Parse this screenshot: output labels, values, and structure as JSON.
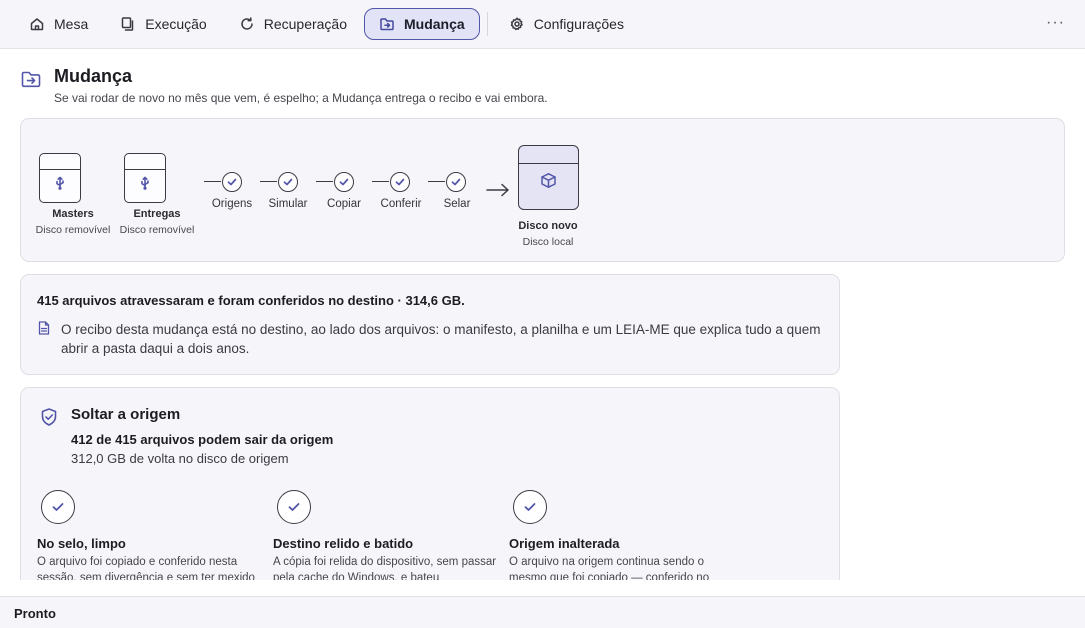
{
  "tabs": [
    {
      "label": "Mesa",
      "icon": "home-icon",
      "active": false
    },
    {
      "label": "Execução",
      "icon": "copy-icon",
      "active": false
    },
    {
      "label": "Recuperação",
      "icon": "refresh-icon",
      "active": false
    },
    {
      "label": "Mudança",
      "icon": "folder-move-icon",
      "active": true
    },
    {
      "label": "Configurações",
      "icon": "gear-icon",
      "active": false
    }
  ],
  "more_label": "···",
  "header": {
    "title": "Mudança",
    "subtitle": "Se vai rodar de novo no mês que vem, é espelho; a Mudança entrega o recibo e vai embora."
  },
  "flow": {
    "sources": [
      {
        "name": "Masters",
        "kind": "Disco removível",
        "icon": "usb-icon"
      },
      {
        "name": "Entregas",
        "kind": "Disco removível",
        "icon": "usb-icon"
      }
    ],
    "steps": [
      "Origens",
      "Simular",
      "Copiar",
      "Conferir",
      "Selar"
    ],
    "destination": {
      "name": "Disco novo",
      "kind": "Disco local",
      "icon": "box-icon"
    }
  },
  "summary": {
    "title": "415 arquivos atravessaram e foram conferidos no destino · 314,6 GB.",
    "text": "O recibo desta mudança está no destino, ao lado dos arquivos: o manifesto, a planilha e um LEIA-ME que explica tudo a quem abrir a pasta daqui a dois anos."
  },
  "release": {
    "title": "Soltar a origem",
    "count": "412 de 415 arquivos podem sair da origem",
    "size": "312,0 GB de volta no disco de origem",
    "criteria": [
      {
        "title": "No selo, limpo",
        "text": "O arquivo foi copiado e conferido nesta sessão, sem divergência e sem ter mexido"
      },
      {
        "title": "Destino relido e batido",
        "text": "A cópia foi relida do dispositivo, sem passar pela cache do Windows, e bateu"
      },
      {
        "title": "Origem inalterada",
        "text": "O arquivo na origem continua sendo o mesmo que foi copiado — conferido no"
      }
    ]
  },
  "status": "Pronto",
  "colors": {
    "accent": "#5356a8",
    "active_tab_bg": "#e2e3f6",
    "card_bg": "#f6f6fa"
  }
}
